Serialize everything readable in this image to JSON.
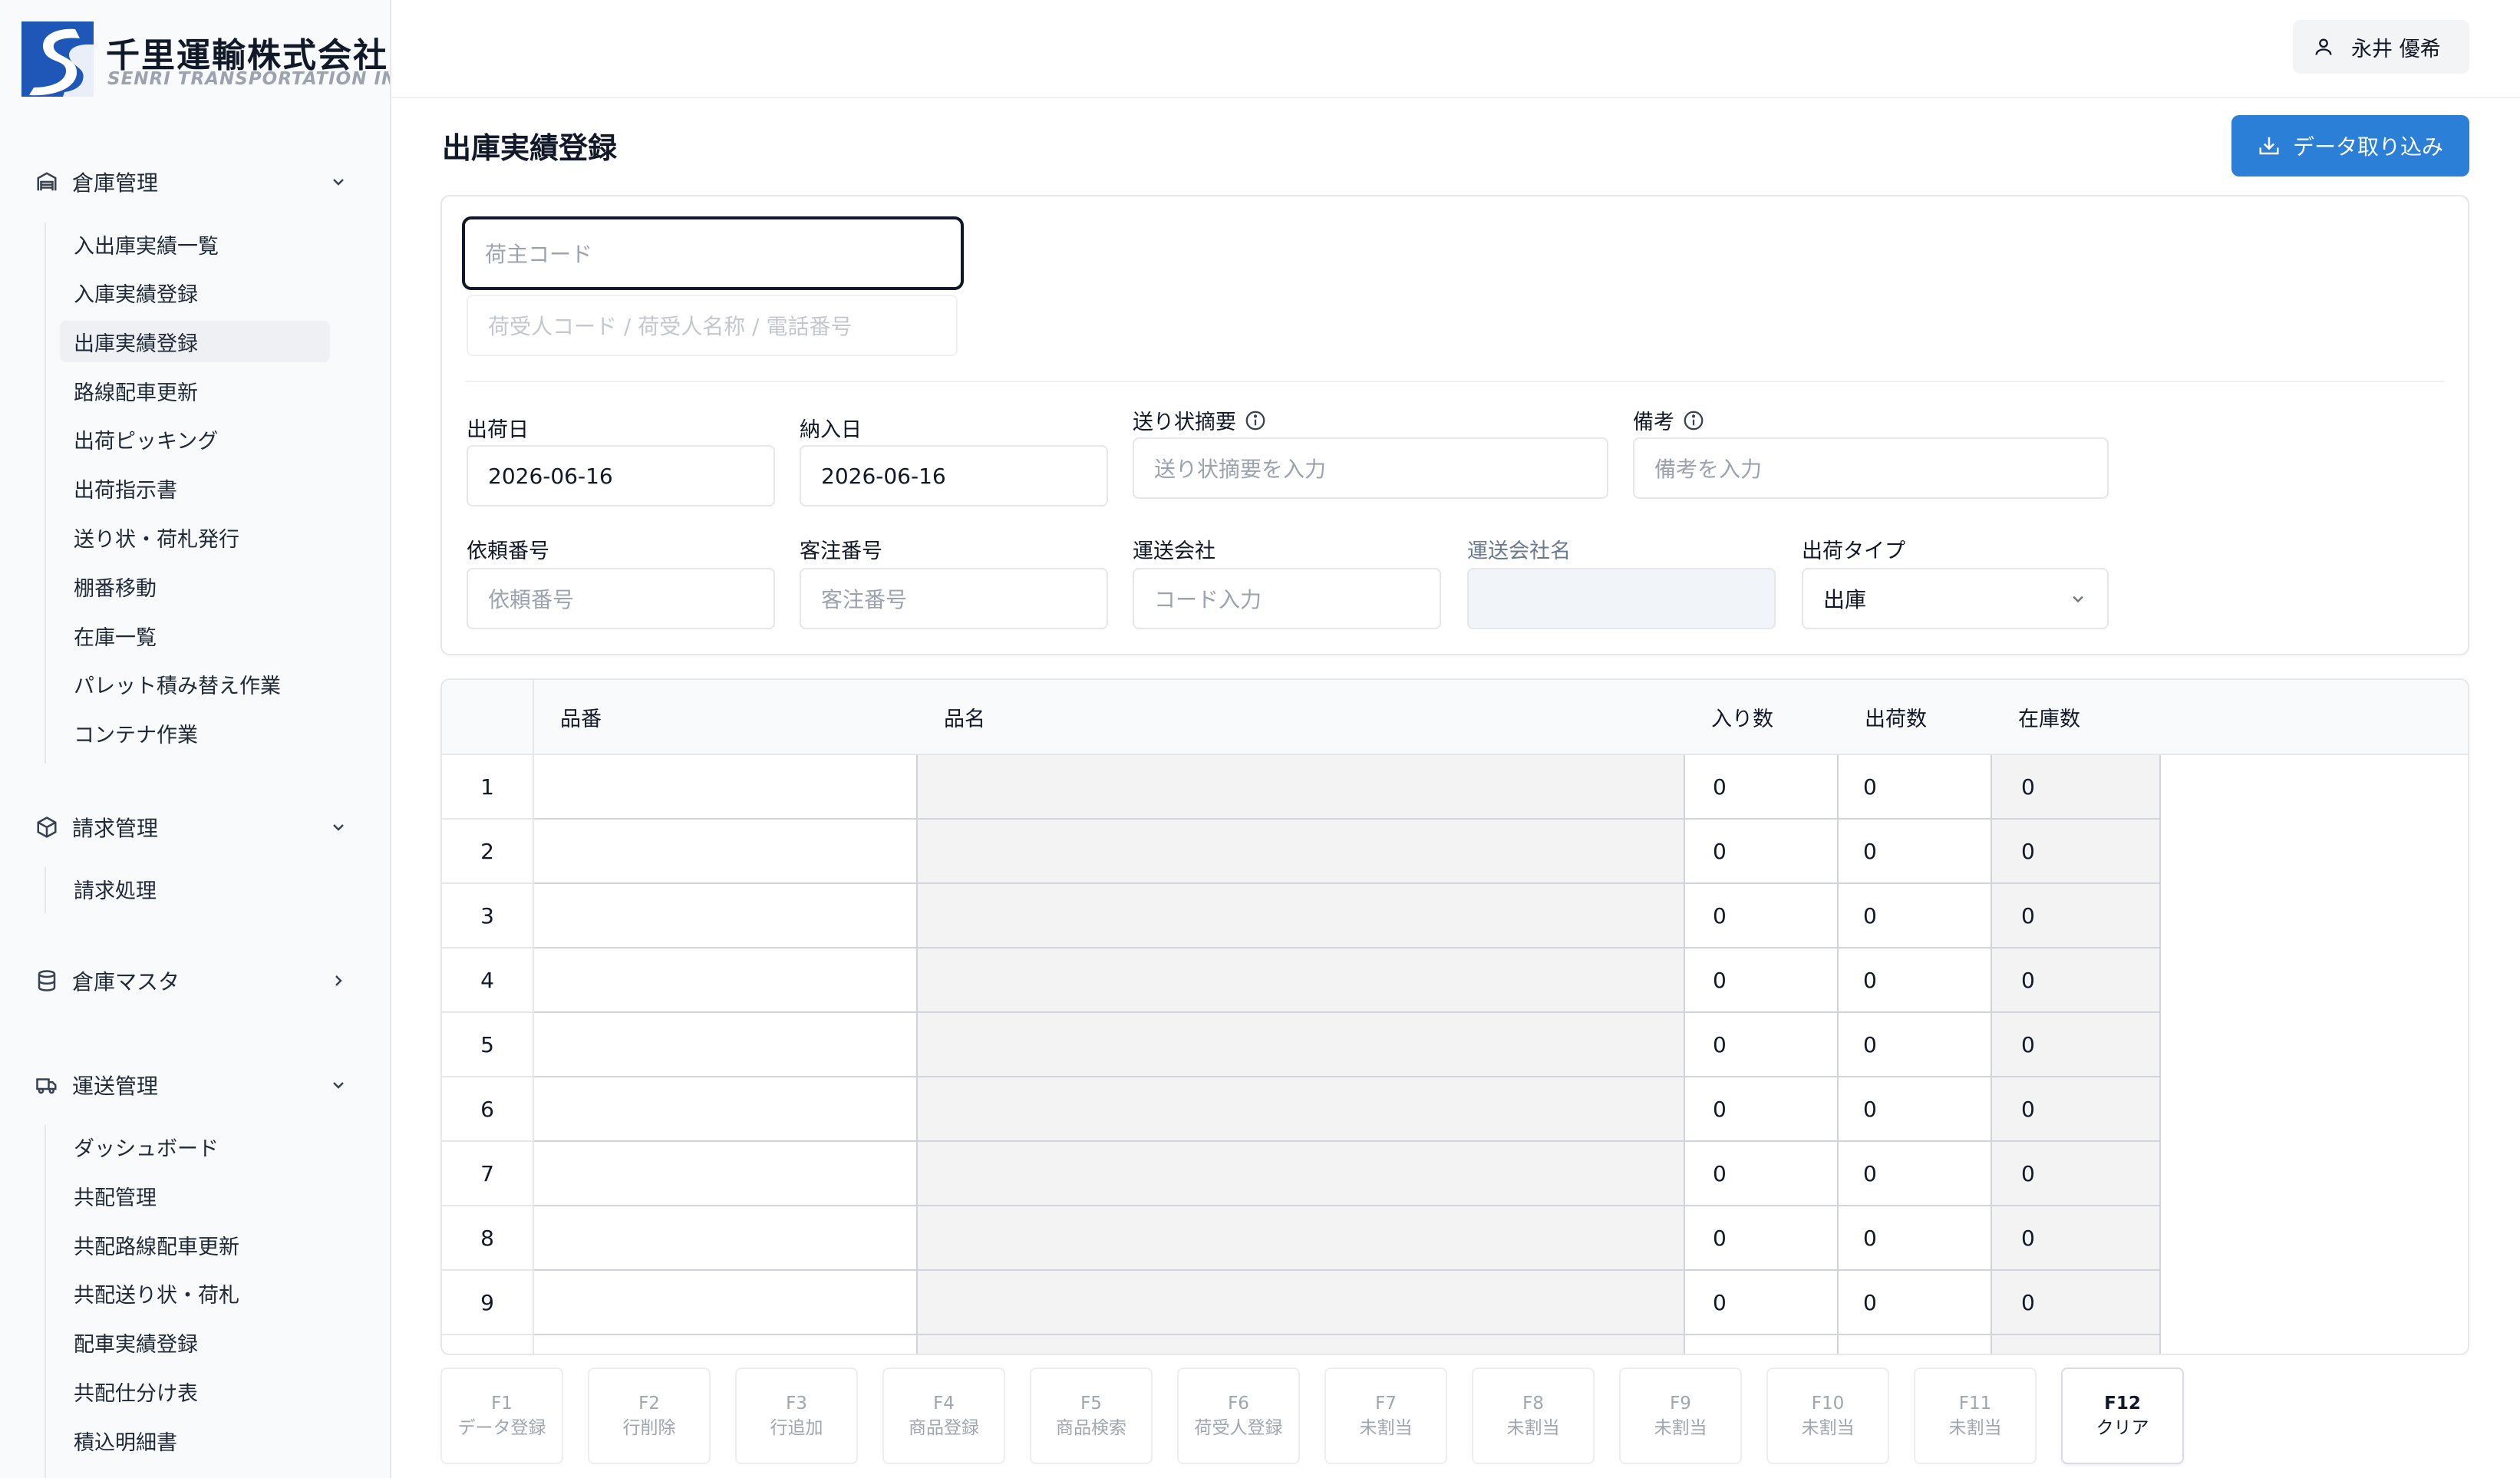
{
  "company": {
    "name_jp": "千里運輸株式会社",
    "name_en": "SENRI TRANSPORTATION INC."
  },
  "user": {
    "name": "永井 優希"
  },
  "sidebar": {
    "sections": [
      {
        "title": "倉庫管理",
        "icon": "warehouse-icon",
        "expanded": true,
        "items": [
          "入出庫実績一覧",
          "入庫実績登録",
          "出庫実績登録",
          "路線配車更新",
          "出荷ピッキング",
          "出荷指示書",
          "送り状・荷札発行",
          "棚番移動",
          "在庫一覧",
          "パレット積み替え作業",
          "コンテナ作業"
        ]
      },
      {
        "title": "請求管理",
        "icon": "package-icon",
        "expanded": true,
        "items": [
          "請求処理"
        ]
      },
      {
        "title": "倉庫マスタ",
        "icon": "database-icon",
        "expanded": false,
        "items": []
      },
      {
        "title": "運送管理",
        "icon": "truck-icon",
        "expanded": true,
        "items": [
          "ダッシュボード",
          "共配管理",
          "共配路線配車更新",
          "共配送り状・荷札",
          "配車実績登録",
          "共配仕分け表",
          "積込明細書"
        ]
      }
    ],
    "active_item": "出庫実績登録"
  },
  "page": {
    "title": "出庫実績登録",
    "import_button": "データ取り込み"
  },
  "form": {
    "shipper_code": {
      "placeholder": "荷主コード"
    },
    "consignee": {
      "placeholder": "荷受人コード / 荷受人名称 / 電話番号"
    },
    "ship_date": {
      "label": "出荷日",
      "value": "2026-06-16"
    },
    "delivery_date": {
      "label": "納入日",
      "value": "2026-06-16"
    },
    "invoice_summary": {
      "label": "送り状摘要",
      "placeholder": "送り状摘要を入力"
    },
    "remarks": {
      "label": "備考",
      "placeholder": "備考を入力"
    },
    "request_no": {
      "label": "依頼番号",
      "placeholder": "依頼番号"
    },
    "order_no": {
      "label": "客注番号",
      "placeholder": "客注番号"
    },
    "carrier": {
      "label": "運送会社",
      "placeholder": "コード入力"
    },
    "carrier_name": {
      "label": "運送会社名",
      "value": ""
    },
    "ship_type": {
      "label": "出荷タイプ",
      "value": "出庫"
    }
  },
  "grid": {
    "headers": {
      "code": "品番",
      "name": "品名",
      "qty": "入り数",
      "ship": "出荷数",
      "stock": "在庫数"
    },
    "rows": [
      {
        "index": "1",
        "code": "",
        "name": "",
        "qty": "0",
        "ship": "0",
        "stock": "0"
      },
      {
        "index": "2",
        "code": "",
        "name": "",
        "qty": "0",
        "ship": "0",
        "stock": "0"
      },
      {
        "index": "3",
        "code": "",
        "name": "",
        "qty": "0",
        "ship": "0",
        "stock": "0"
      },
      {
        "index": "4",
        "code": "",
        "name": "",
        "qty": "0",
        "ship": "0",
        "stock": "0"
      },
      {
        "index": "5",
        "code": "",
        "name": "",
        "qty": "0",
        "ship": "0",
        "stock": "0"
      },
      {
        "index": "6",
        "code": "",
        "name": "",
        "qty": "0",
        "ship": "0",
        "stock": "0"
      },
      {
        "index": "7",
        "code": "",
        "name": "",
        "qty": "0",
        "ship": "0",
        "stock": "0"
      },
      {
        "index": "8",
        "code": "",
        "name": "",
        "qty": "0",
        "ship": "0",
        "stock": "0"
      },
      {
        "index": "9",
        "code": "",
        "name": "",
        "qty": "0",
        "ship": "0",
        "stock": "0"
      }
    ]
  },
  "function_keys": [
    {
      "key": "F1",
      "label": "データ登録",
      "enabled": false
    },
    {
      "key": "F2",
      "label": "行削除",
      "enabled": false
    },
    {
      "key": "F3",
      "label": "行追加",
      "enabled": false
    },
    {
      "key": "F4",
      "label": "商品登録",
      "enabled": false
    },
    {
      "key": "F5",
      "label": "商品検索",
      "enabled": false
    },
    {
      "key": "F6",
      "label": "荷受人登録",
      "enabled": false
    },
    {
      "key": "F7",
      "label": "未割当",
      "enabled": false
    },
    {
      "key": "F8",
      "label": "未割当",
      "enabled": false
    },
    {
      "key": "F9",
      "label": "未割当",
      "enabled": false
    },
    {
      "key": "F10",
      "label": "未割当",
      "enabled": false
    },
    {
      "key": "F11",
      "label": "未割当",
      "enabled": false
    },
    {
      "key": "F12",
      "label": "クリア",
      "enabled": true
    }
  ],
  "colors": {
    "primary": "#2b7fd6",
    "border": "#e5e7eb",
    "readonly_cell": "#f3f3f3",
    "sidebar_bg": "#f9fafb"
  }
}
